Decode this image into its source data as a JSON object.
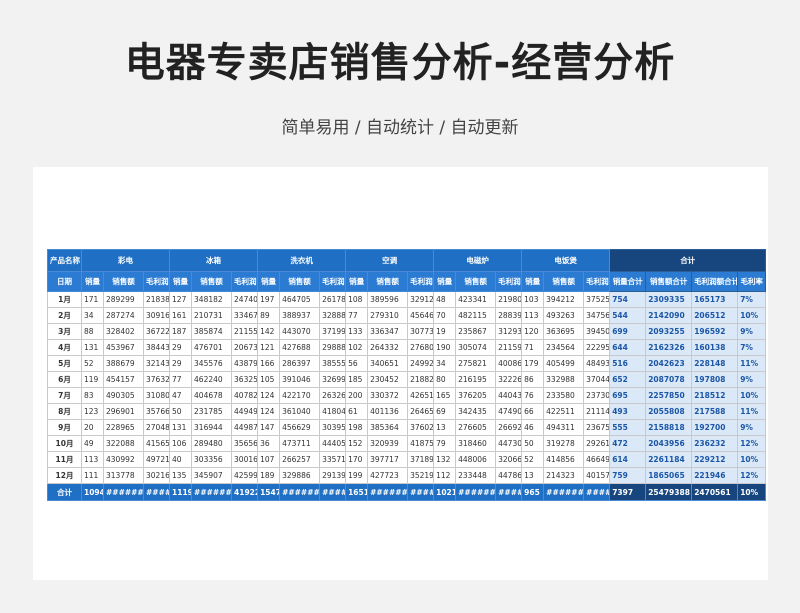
{
  "title": "电器专卖店销售分析-经营分析",
  "subtitle": "简单易用 / 自动统计 / 自动更新",
  "table": {
    "corner_top": "产品名称",
    "corner_bottom": "日期",
    "products": [
      "彩电",
      "冰箱",
      "洗衣机",
      "空调",
      "电磁炉",
      "电饭煲",
      "合计"
    ],
    "sub_headers": [
      "销量",
      "销售额",
      "毛利润"
    ],
    "total_sub_headers": [
      "销量合计",
      "销售额合计",
      "毛利润额合计",
      "毛利率"
    ],
    "rows": [
      {
        "m": "1月",
        "d": [
          "171",
          "289299",
          "21838",
          "127",
          "348182",
          "24740",
          "197",
          "464705",
          "26178",
          "108",
          "389596",
          "32912",
          "48",
          "423341",
          "21980",
          "103",
          "394212",
          "37525"
        ],
        "t": [
          "754",
          "2309335",
          "165173",
          "7%"
        ]
      },
      {
        "m": "2月",
        "d": [
          "34",
          "287274",
          "30916",
          "161",
          "210731",
          "33467",
          "89",
          "388937",
          "32888",
          "77",
          "279310",
          "45646",
          "70",
          "482115",
          "28839",
          "113",
          "493263",
          "34756"
        ],
        "t": [
          "544",
          "2142090",
          "206512",
          "10%"
        ]
      },
      {
        "m": "3月",
        "d": [
          "88",
          "328402",
          "36722",
          "187",
          "385874",
          "21155",
          "142",
          "443070",
          "37199",
          "133",
          "336347",
          "30773",
          "19",
          "235867",
          "31293",
          "120",
          "363695",
          "39450"
        ],
        "t": [
          "699",
          "2093255",
          "196592",
          "9%"
        ]
      },
      {
        "m": "4月",
        "d": [
          "131",
          "453967",
          "38443",
          "29",
          "476701",
          "20673",
          "121",
          "427688",
          "29888",
          "102",
          "264332",
          "27680",
          "190",
          "305074",
          "21159",
          "71",
          "234564",
          "22295"
        ],
        "t": [
          "644",
          "2162326",
          "160138",
          "7%"
        ]
      },
      {
        "m": "5月",
        "d": [
          "52",
          "388679",
          "32143",
          "29",
          "345576",
          "43879",
          "166",
          "286397",
          "38555",
          "56",
          "340651",
          "24992",
          "34",
          "275821",
          "40086",
          "179",
          "405499",
          "48493"
        ],
        "t": [
          "516",
          "2042623",
          "228148",
          "11%"
        ]
      },
      {
        "m": "6月",
        "d": [
          "119",
          "454157",
          "37632",
          "77",
          "462240",
          "36325",
          "105",
          "391046",
          "32699",
          "185",
          "230452",
          "21882",
          "80",
          "216195",
          "32226",
          "86",
          "332988",
          "37044"
        ],
        "t": [
          "652",
          "2087078",
          "197808",
          "9%"
        ]
      },
      {
        "m": "7月",
        "d": [
          "83",
          "490305",
          "31080",
          "47",
          "404678",
          "40782",
          "124",
          "422170",
          "26326",
          "200",
          "330372",
          "42651",
          "165",
          "376205",
          "44043",
          "76",
          "233580",
          "23730"
        ],
        "t": [
          "695",
          "2257850",
          "218512",
          "10%"
        ]
      },
      {
        "m": "8月",
        "d": [
          "123",
          "296901",
          "35766",
          "50",
          "231785",
          "44949",
          "124",
          "361040",
          "41804",
          "61",
          "401136",
          "26465",
          "69",
          "342435",
          "47490",
          "66",
          "422511",
          "21114"
        ],
        "t": [
          "493",
          "2055808",
          "217588",
          "11%"
        ]
      },
      {
        "m": "9月",
        "d": [
          "20",
          "228965",
          "27048",
          "131",
          "316944",
          "44987",
          "147",
          "456629",
          "30395",
          "198",
          "385364",
          "37602",
          "13",
          "276605",
          "26692",
          "46",
          "494311",
          "23675"
        ],
        "t": [
          "555",
          "2158818",
          "192700",
          "9%"
        ]
      },
      {
        "m": "10月",
        "d": [
          "49",
          "322088",
          "41565",
          "106",
          "289480",
          "35656",
          "36",
          "473711",
          "44405",
          "152",
          "320939",
          "41875",
          "79",
          "318460",
          "44730",
          "50",
          "319278",
          "29261"
        ],
        "t": [
          "472",
          "2043956",
          "236232",
          "12%"
        ]
      },
      {
        "m": "11月",
        "d": [
          "113",
          "430992",
          "49721",
          "40",
          "303356",
          "30016",
          "107",
          "266257",
          "33571",
          "170",
          "397717",
          "37189",
          "132",
          "448006",
          "32066",
          "52",
          "414856",
          "46649"
        ],
        "t": [
          "614",
          "2261184",
          "229212",
          "10%"
        ]
      },
      {
        "m": "12月",
        "d": [
          "111",
          "313778",
          "30216",
          "135",
          "345907",
          "42599",
          "189",
          "329886",
          "29139",
          "199",
          "427723",
          "35219",
          "112",
          "233448",
          "44786",
          "13",
          "214323",
          "40157"
        ],
        "t": [
          "759",
          "1865065",
          "221946",
          "12%"
        ]
      }
    ],
    "total": {
      "m": "合计",
      "d": [
        "1094",
        "######",
        "######",
        "1119",
        "######",
        "419228",
        "1547",
        "######",
        "######",
        "1651",
        "######",
        "######",
        "1021",
        "######",
        "######",
        "965",
        "######",
        "######"
      ],
      "t": [
        "7397",
        "25479388",
        "2470561",
        "10%"
      ]
    }
  }
}
